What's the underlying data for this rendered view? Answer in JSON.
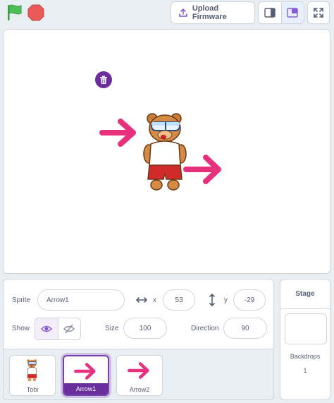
{
  "toolbar": {
    "flag_icon": "green-flag-icon",
    "stop_icon": "stop-icon",
    "upload_label": "Upload Firmware",
    "upload_icon": "upload-icon",
    "layout_buttons": [
      "small-stage-icon",
      "large-stage-icon"
    ],
    "fullscreen_icon": "fullscreen-icon"
  },
  "colors": {
    "flag": "#4cbf56",
    "stop": "#ec5959",
    "arrow": "#e8317c",
    "selected": "#6a2e9c",
    "eye": "#855cd6"
  },
  "sprite_info": {
    "sprite_label": "Sprite",
    "sprite_name": "Arrow1",
    "x_label": "x",
    "x_value": "53",
    "y_label": "y",
    "y_value": "-29",
    "show_label": "Show",
    "size_label": "Size",
    "size_value": "100",
    "direction_label": "Direction",
    "direction_value": "90"
  },
  "sprites": [
    {
      "name": "Tobi",
      "icon": "bear-sprite-icon",
      "selected": false
    },
    {
      "name": "Arrow1",
      "icon": "arrow-sprite-icon",
      "selected": true
    },
    {
      "name": "Arrow2",
      "icon": "arrow-sprite-icon",
      "selected": false
    }
  ],
  "stage_panel": {
    "title": "Stage",
    "backdrops_label": "Backdrops",
    "backdrops_count": "1"
  }
}
